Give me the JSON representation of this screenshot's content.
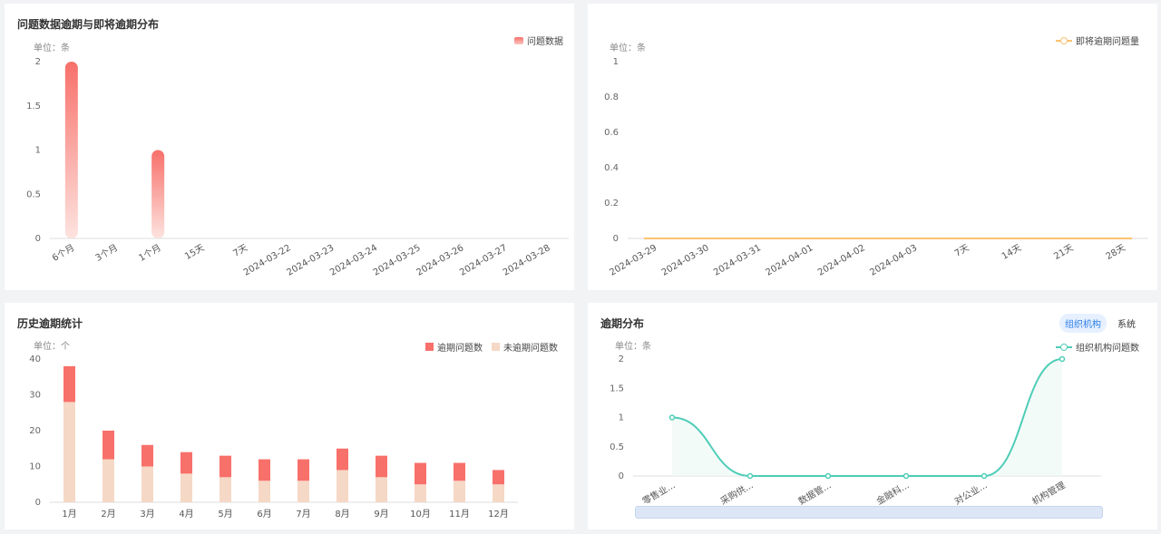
{
  "panels": {
    "p1": {
      "title": "问题数据逾期与即将逾期分布",
      "unit": "单位：条",
      "legend": "问题数据"
    },
    "p2": {
      "title": "",
      "unit": "单位：条",
      "legend": "即将逾期问题量"
    },
    "p3": {
      "title": "历史逾期统计",
      "unit": "单位：个",
      "legend1": "逾期问题数",
      "legend2": "未逾期问题数"
    },
    "p4": {
      "title": "逾期分布",
      "unit": "单位：条",
      "legend": "组织机构问题数",
      "tabs": [
        "组织机构",
        "系统"
      ]
    }
  },
  "colors": {
    "red": "#f8706a",
    "peach": "#f6d8c6",
    "orange": "#f9c26f",
    "teal": "#4ecdb7"
  },
  "chart_data": [
    {
      "type": "bar",
      "title": "问题数据逾期与即将逾期分布",
      "categories": [
        "6个月",
        "3个月",
        "1个月",
        "15天",
        "7天",
        "2024-03-22",
        "2024-03-23",
        "2024-03-24",
        "2024-03-25",
        "2024-03-26",
        "2024-03-27",
        "2024-03-28"
      ],
      "series": [
        {
          "name": "问题数据",
          "values": [
            2,
            0,
            1,
            0,
            0,
            0,
            0,
            0,
            0,
            0,
            0,
            0
          ]
        }
      ],
      "yticks": [
        "0",
        "0.5",
        "1",
        "1.5",
        "2"
      ],
      "ylim": [
        0,
        2
      ]
    },
    {
      "type": "line",
      "categories": [
        "2024-03-29",
        "2024-03-30",
        "2024-03-31",
        "2024-04-01",
        "2024-04-02",
        "2024-04-03",
        "7天",
        "14天",
        "21天",
        "28天"
      ],
      "series": [
        {
          "name": "即将逾期问题量",
          "values": [
            0,
            0,
            0,
            0,
            0,
            0,
            0,
            0,
            0,
            0
          ]
        }
      ],
      "yticks": [
        "0",
        "0.2",
        "0.4",
        "0.6",
        "0.8",
        "1"
      ],
      "ylim": [
        0,
        1
      ]
    },
    {
      "type": "bar",
      "title": "历史逾期统计",
      "stacked": true,
      "categories": [
        "1月",
        "2月",
        "3月",
        "4月",
        "5月",
        "6月",
        "7月",
        "8月",
        "9月",
        "10月",
        "11月",
        "12月"
      ],
      "series": [
        {
          "name": "逾期问题数",
          "values": [
            10,
            8,
            6,
            6,
            6,
            6,
            6,
            6,
            6,
            6,
            5,
            4
          ]
        },
        {
          "name": "未逾期问题数",
          "values": [
            28,
            12,
            10,
            8,
            7,
            6,
            6,
            9,
            7,
            5,
            6,
            5
          ]
        }
      ],
      "yticks": [
        "0",
        "10",
        "20",
        "30",
        "40"
      ],
      "ylim": [
        0,
        40
      ]
    },
    {
      "type": "line",
      "title": "逾期分布",
      "categories": [
        "零售业...",
        "采购供...",
        "数据管...",
        "金融科...",
        "对公业...",
        "机构管理"
      ],
      "series": [
        {
          "name": "组织机构问题数",
          "values": [
            1,
            0,
            0,
            0,
            0,
            2
          ]
        }
      ],
      "yticks": [
        "0",
        "0.5",
        "1",
        "1.5",
        "2"
      ],
      "ylim": [
        0,
        2
      ]
    }
  ]
}
